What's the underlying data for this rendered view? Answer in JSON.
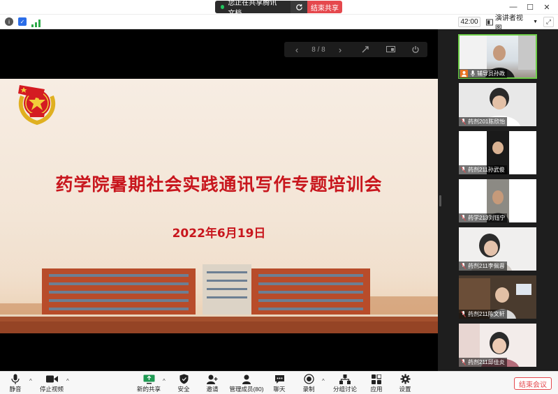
{
  "title_bar": {
    "share_status": "您正在共享腾讯文档",
    "stop_share": "结束共享"
  },
  "info_bar": {
    "timer": "42:00",
    "view_mode": "演讲者视图"
  },
  "presentation": {
    "page_indicator": "8 / 8",
    "title": "药学院暑期社会实践通讯写作专题培训会",
    "date": "2022年6月19日",
    "title_color": "#c8161d"
  },
  "participants": [
    {
      "name": "辅导员孙政",
      "active": true,
      "role_icon": "person-icon"
    },
    {
      "name": "药剂201陈欣怡",
      "active": false
    },
    {
      "name": "药剂211孙武俊",
      "active": false
    },
    {
      "name": "药学213刘钰宁",
      "active": false
    },
    {
      "name": "药剂211李佩蓉",
      "active": false
    },
    {
      "name": "药剂211陈文轩",
      "active": false
    },
    {
      "name": "药剂211邱佳炎",
      "active": false
    }
  ],
  "toolbar": {
    "mute": "静音",
    "stop_video": "停止视频",
    "new_share": "新的共享",
    "security": "安全",
    "invite": "邀请",
    "members": "管理成员(80)",
    "chat": "聊天",
    "record": "录制",
    "breakout": "分组讨论",
    "apps": "应用",
    "settings": "设置",
    "end_meeting": "结束会议"
  },
  "colors": {
    "accent_red": "#e5484d",
    "active_speaker": "#6fcf4a",
    "sharing_dot": "#22c55e"
  }
}
